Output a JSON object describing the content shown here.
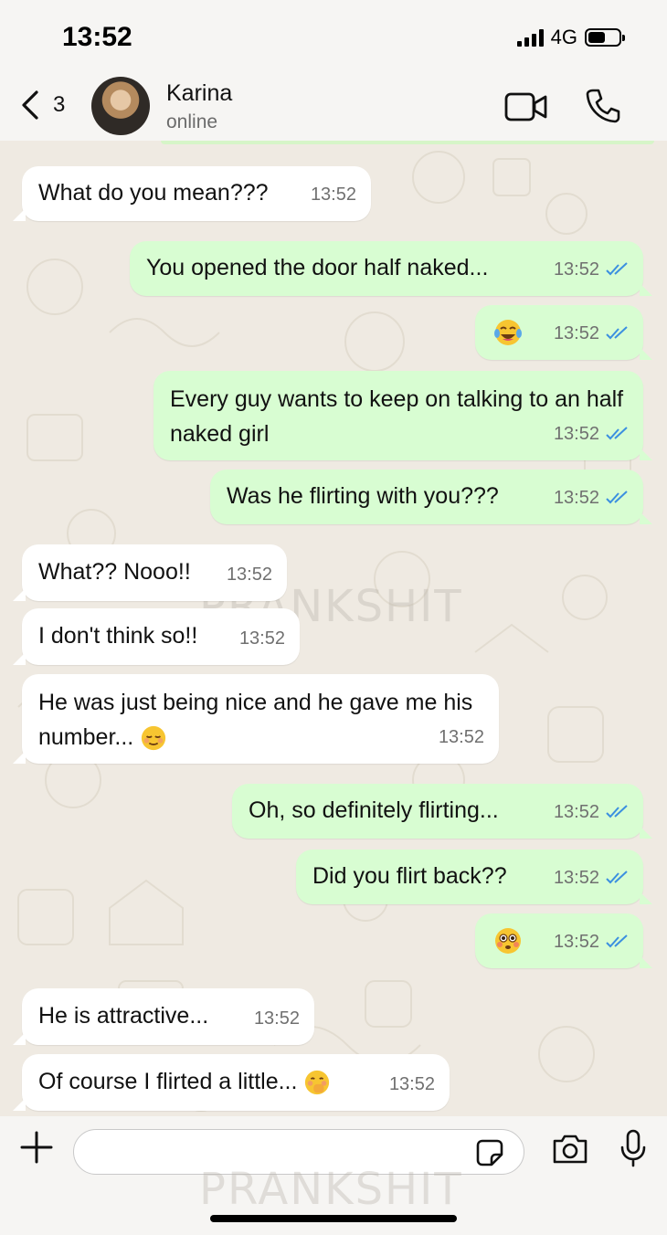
{
  "status_bar": {
    "time": "13:52",
    "network": "4G",
    "battery_level": 0.55
  },
  "header": {
    "back_count": "3",
    "contact_name": "Karina",
    "contact_status": "online"
  },
  "watermark": "PRANKSHIT",
  "messages": [
    {
      "dir": "in",
      "text": "What do you mean???",
      "time": "13:52"
    },
    {
      "dir": "out",
      "text": "You opened the door half naked...",
      "time": "13:52",
      "read": true
    },
    {
      "dir": "out",
      "text": "",
      "emoji": "tears-of-joy-emoji",
      "time": "13:52",
      "read": true
    },
    {
      "dir": "out",
      "text": "Every guy wants to keep on talking to an half naked girl",
      "time": "13:52",
      "read": true
    },
    {
      "dir": "out",
      "text": "Was he flirting with you???",
      "time": "13:52",
      "read": true
    },
    {
      "dir": "in",
      "text": "What?? Nooo!!",
      "time": "13:52"
    },
    {
      "dir": "in",
      "text": "I don't think so!!",
      "time": "13:52"
    },
    {
      "dir": "in",
      "text": "He was just being nice and he gave me his number...",
      "emoji": "relieved-face-emoji",
      "time": "13:52"
    },
    {
      "dir": "out",
      "text": "Oh, so definitely flirting...",
      "time": "13:52",
      "read": true
    },
    {
      "dir": "out",
      "text": "Did you flirt back??",
      "time": "13:52",
      "read": true
    },
    {
      "dir": "out",
      "text": "",
      "emoji": "flushed-face-emoji",
      "time": "13:52",
      "read": true
    },
    {
      "dir": "in",
      "text": "He is attractive...",
      "time": "13:52"
    },
    {
      "dir": "in",
      "text": "Of course I flirted a little...",
      "emoji": "face-with-hand-over-mouth-emoji",
      "time": "13:52"
    }
  ],
  "input": {
    "placeholder": "",
    "value": ""
  },
  "colors": {
    "outgoing_bubble": "#d8fdd2",
    "incoming_bubble": "#ffffff",
    "read_ticks": "#3b8fe0",
    "chat_bg": "#efeae2"
  }
}
